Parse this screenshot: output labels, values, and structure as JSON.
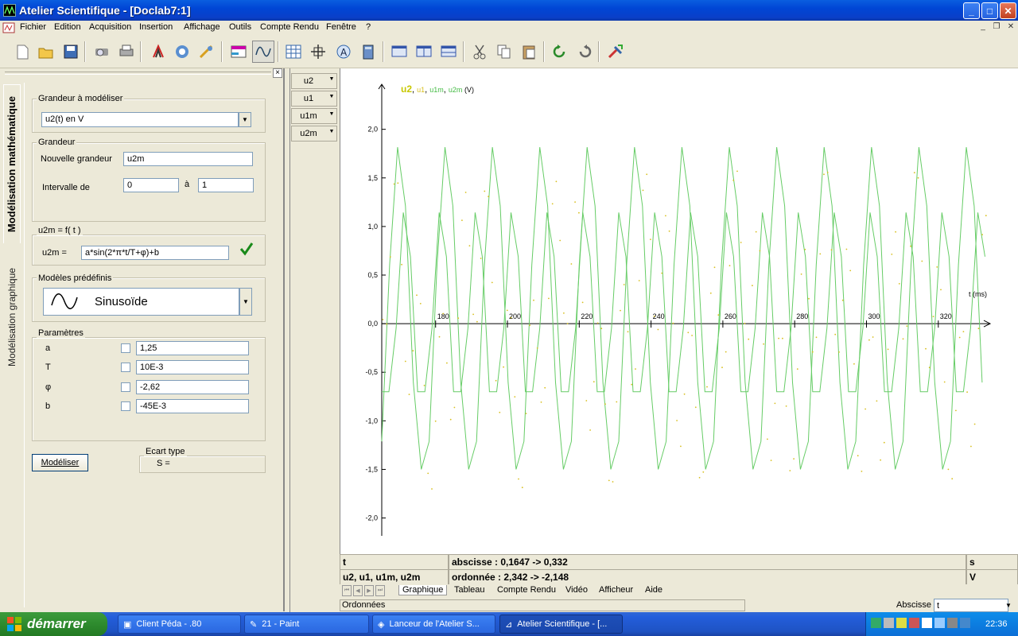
{
  "window": {
    "title": "Atelier Scientifique - [Doclab7:1]",
    "controls": {
      "minimize": "_",
      "maximize": "□",
      "close": "✕"
    }
  },
  "menu": {
    "items": [
      "Fichier",
      "Edition",
      "Acquisition",
      "Insertion",
      "Affichage",
      "Outils",
      "Compte Rendu",
      "Fenêtre",
      "?"
    ],
    "mdi_controls": [
      "_",
      "❐",
      "✕"
    ]
  },
  "left_panel": {
    "close": "×",
    "tabs": {
      "active": "Modélisation mathématique",
      "inactive": "Modélisation graphique"
    },
    "grandeur_a_modeliser": {
      "label": "Grandeur à modéliser",
      "value": "u2(t) en V"
    },
    "grandeur": {
      "label": "Grandeur",
      "nouvelle_label": "Nouvelle grandeur",
      "nouvelle_value": "u2m",
      "intervalle_label": "Intervalle de",
      "from": "0",
      "a_label": "à",
      "to": "1"
    },
    "equation": {
      "label": "u2m = f( t )",
      "lhs": "u2m =",
      "expr": "a*sin(2*π*t/T+φ)+b",
      "valid_icon": "check-icon"
    },
    "modeles": {
      "label": "Modèles prédéfinis",
      "value": "Sinusoïde"
    },
    "parametres": {
      "label": "Paramètres",
      "rows": [
        {
          "name": "a",
          "value": "1,25"
        },
        {
          "name": "T",
          "value": "10E-3"
        },
        {
          "name": "φ",
          "value": "-2,62"
        },
        {
          "name": "b",
          "value": "-45E-3"
        }
      ]
    },
    "modeliser_button": "Modéliser",
    "ecart": {
      "label": "Ecart type",
      "value": "S ="
    }
  },
  "curve_selector": [
    "u2",
    "u1",
    "u1m",
    "u2m"
  ],
  "chart_data": {
    "type": "line",
    "legend": {
      "u2": "u2",
      "sep1": ", ",
      "u1": "u1",
      "sep2": ", ",
      "u1m": "u1m",
      "sep3": ", ",
      "u2m": "u2m",
      "unit": " (V)"
    },
    "xlabel": "t (ms)",
    "x_ticks": [
      "180",
      "200",
      "220",
      "240",
      "260",
      "280",
      "300",
      "320"
    ],
    "y_ticks": [
      "2,0",
      "1,5",
      "1,0",
      "0,5",
      "0,0",
      "-0,5",
      "-1,0",
      "-1,5",
      "-2,0"
    ],
    "xlim": [
      165,
      334
    ],
    "ylim": [
      -2.2,
      2.3
    ],
    "series": [
      {
        "name": "u1m",
        "color": "#66cc66",
        "period_ms": 13.2,
        "phase_ms": 166.5,
        "amplitude": 1.85,
        "offset": 0
      },
      {
        "name": "u2m",
        "color": "#66cc66",
        "period_ms": 10,
        "phase_ms": 169,
        "peaks": [
          1.2,
          -0.7,
          -1.5
        ]
      },
      {
        "name": "u2",
        "color": "#d8c020",
        "style": "dots"
      }
    ],
    "colors": {
      "u2": "#c8c800",
      "u1": "#d8c020",
      "u1m": "#44bb44",
      "u2m": "#44bb44"
    }
  },
  "info": {
    "x_name": "t",
    "abscisse": "abscisse : 0,1647  -> 0,332",
    "x_unit": "s",
    "y_names": "u2, u1, u1m, u2m",
    "ordonnee": "ordonnée : 2,342  -> -2,148",
    "y_unit": "V"
  },
  "bottom_tabs": [
    "Graphique",
    "Tableau",
    "Compte Rendu",
    "Vidéo",
    "Afficheur",
    "Aide"
  ],
  "status": {
    "ordonnees": "Ordonnées",
    "abscisse_label": "Abscisse",
    "abscisse_value": "t"
  },
  "taskbar": {
    "start": "démarrer",
    "tasks": [
      "Client Péda - .80",
      "21 - Paint",
      "Lanceur de l'Atelier S...",
      "Atelier Scientifique - [..."
    ],
    "clock": "22:36"
  }
}
